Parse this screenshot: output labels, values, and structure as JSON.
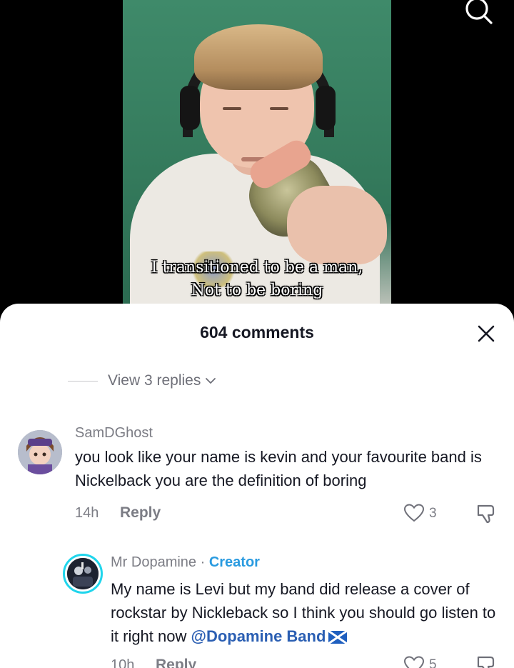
{
  "video": {
    "caption_line1": "I transitioned to be a man,",
    "caption_line2": "Not to be boring",
    "search_icon": "search-icon"
  },
  "sheet": {
    "title": "604 comments",
    "close_icon": "close-icon",
    "view_replies": "View 3 replies"
  },
  "comments": [
    {
      "username": "SamDGhost",
      "text": "you look like your name is kevin and your favourite band is Nickelback you are the definition of boring",
      "time": "14h",
      "reply_label": "Reply",
      "likes": "3"
    },
    {
      "username": "Mr Dopamine",
      "separator": " · ",
      "badge": "Creator",
      "text": "My name is Levi but my band did release a cover of rockstar by Nickleback so I think you should go listen to it right now ",
      "mention": "@Dopamine Band",
      "time": "10h",
      "reply_label": "Reply",
      "likes": "5"
    }
  ],
  "colors": {
    "accent_creator": "#2a9be0",
    "mention": "#2b5fb3",
    "text_primary": "#161823",
    "text_secondary": "#7c7d85",
    "avatar_ring": "#20d5ec"
  }
}
